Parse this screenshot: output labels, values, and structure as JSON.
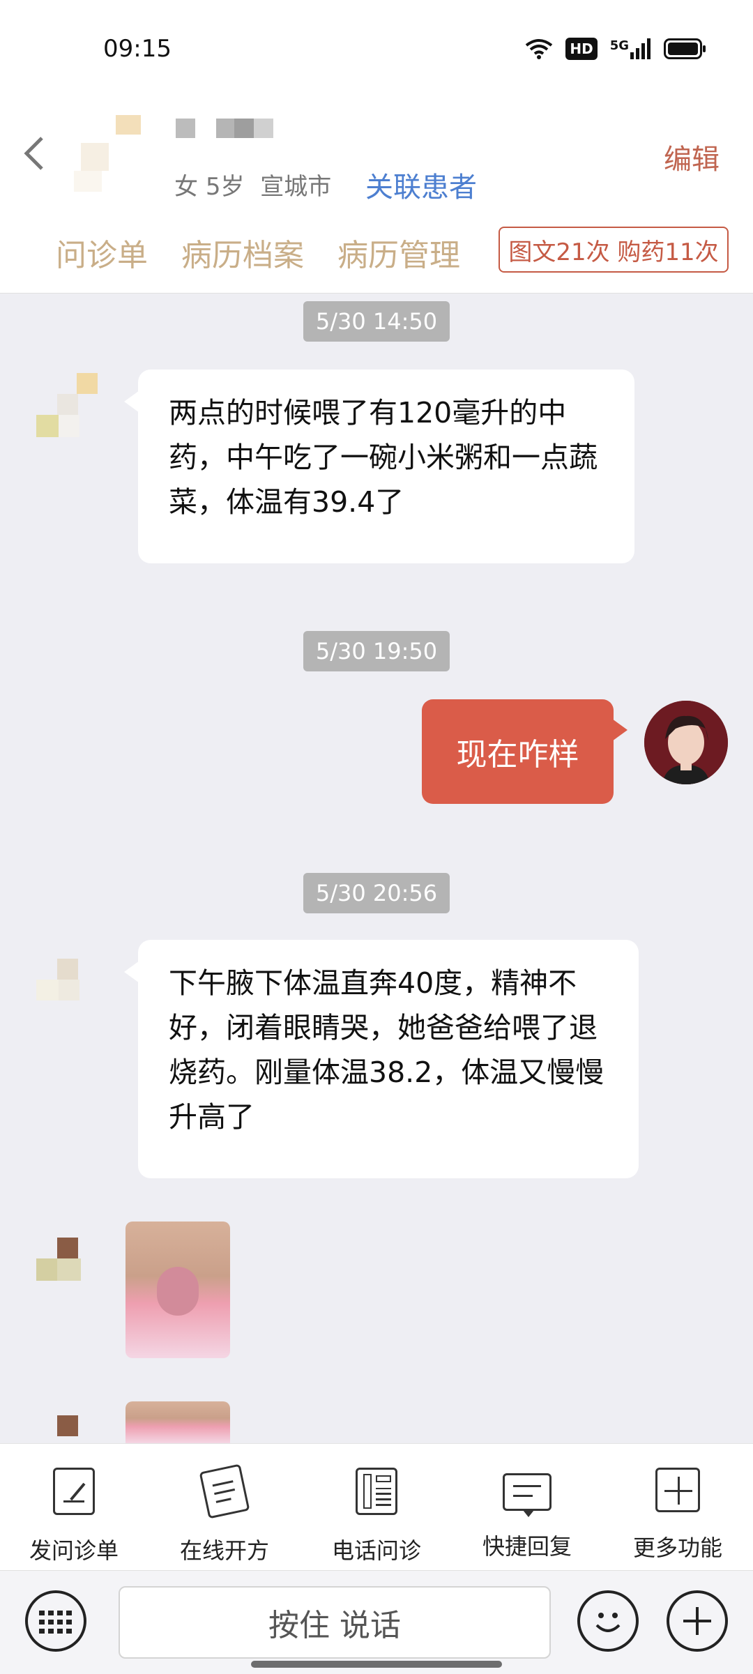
{
  "status_bar": {
    "time": "09:15",
    "hd": "HD",
    "network": "5G"
  },
  "header": {
    "patient_sex": "女",
    "patient_age": "5岁",
    "patient_city": "宣城市",
    "link_patient": "关联患者",
    "edit": "编辑",
    "tabs": [
      "问诊单",
      "病历档案",
      "病历管理"
    ],
    "counts": "图文21次 购药11次"
  },
  "messages": [
    {
      "timestamp": "5/30 14:50",
      "sender": "patient",
      "text": "两点的时候喂了有120毫升的中药，中午吃了一碗小米粥和一点蔬菜，体温有39.4了"
    },
    {
      "timestamp": "5/30 19:50",
      "sender": "doctor",
      "text": "现在咋样"
    },
    {
      "timestamp": "5/30 20:56",
      "sender": "patient",
      "text": "下午腋下体温直奔40度，精神不好，闭着眼睛哭，她爸爸给喂了退烧药。刚量体温38.2，体温又慢慢升高了"
    }
  ],
  "toolbar": {
    "items": [
      {
        "label": "发问诊单",
        "icon": "form-edit-icon"
      },
      {
        "label": "在线开方",
        "icon": "prescription-icon"
      },
      {
        "label": "电话问诊",
        "icon": "phone-icon"
      },
      {
        "label": "快捷回复",
        "icon": "quick-reply-icon"
      },
      {
        "label": "更多功能",
        "icon": "plus-square-icon"
      }
    ]
  },
  "input": {
    "voice_label": "按住 说话"
  },
  "colors": {
    "accent": "#da5c49",
    "link": "#4d7fd0",
    "tab_text": "#c9ae88",
    "bg": "#eeeef3"
  }
}
